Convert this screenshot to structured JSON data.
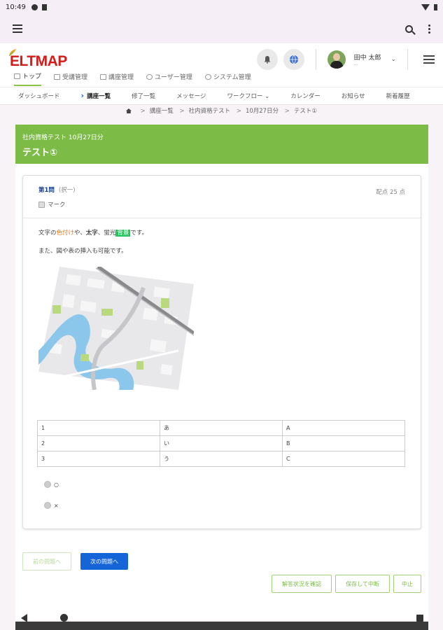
{
  "status": {
    "time": "10:49"
  },
  "logo": {
    "text": "ELTMAP"
  },
  "user": {
    "name": "田中 太郎",
    "sub": "..."
  },
  "main_nav": [
    {
      "label": "トップ",
      "active": true
    },
    {
      "label": "受講管理"
    },
    {
      "label": "講座管理"
    },
    {
      "label": "ユーザー管理"
    },
    {
      "label": "システム管理"
    }
  ],
  "sub_nav": [
    {
      "label": "ダッシュボード"
    },
    {
      "label": "講座一覧",
      "active": true
    },
    {
      "label": "修了一覧"
    },
    {
      "label": "メッセージ"
    },
    {
      "label": "ワークフロー ⌄"
    },
    {
      "label": "カレンダー"
    },
    {
      "label": "お知らせ"
    },
    {
      "label": "新着履歴"
    }
  ],
  "breadcrumb": [
    "講座一覧",
    "社内資格テスト",
    "10月27日分",
    "テスト①"
  ],
  "page": {
    "subtitle": "社内資格テスト 10月27日分",
    "title": "テスト①"
  },
  "question": {
    "number": "第1問",
    "type": "(択一)",
    "mark_label": "マーク",
    "points": "配点 25 点",
    "line1_prefix": "文字の",
    "line1_orange": "色付け",
    "line1_mid": "や、",
    "line1_bold": "太字",
    "line1_mid2": "、蛍光",
    "line1_hl": "背景",
    "line1_suffix": "です。",
    "line2": "また、図や表の挿入も可能です。",
    "table": [
      [
        "1",
        "あ",
        "A"
      ],
      [
        "2",
        "い",
        "B"
      ],
      [
        "3",
        "う",
        "C"
      ]
    ],
    "options": [
      "○",
      "×"
    ]
  },
  "buttons": {
    "prev": "前の問題へ",
    "next": "次の問題へ",
    "check": "解答状況を確認",
    "save_pause": "保存して中断",
    "abort": "中止"
  },
  "colors": {
    "accent_green": "#7dbb47",
    "primary_blue": "#1565d8",
    "logo_red": "#d61b1b"
  }
}
